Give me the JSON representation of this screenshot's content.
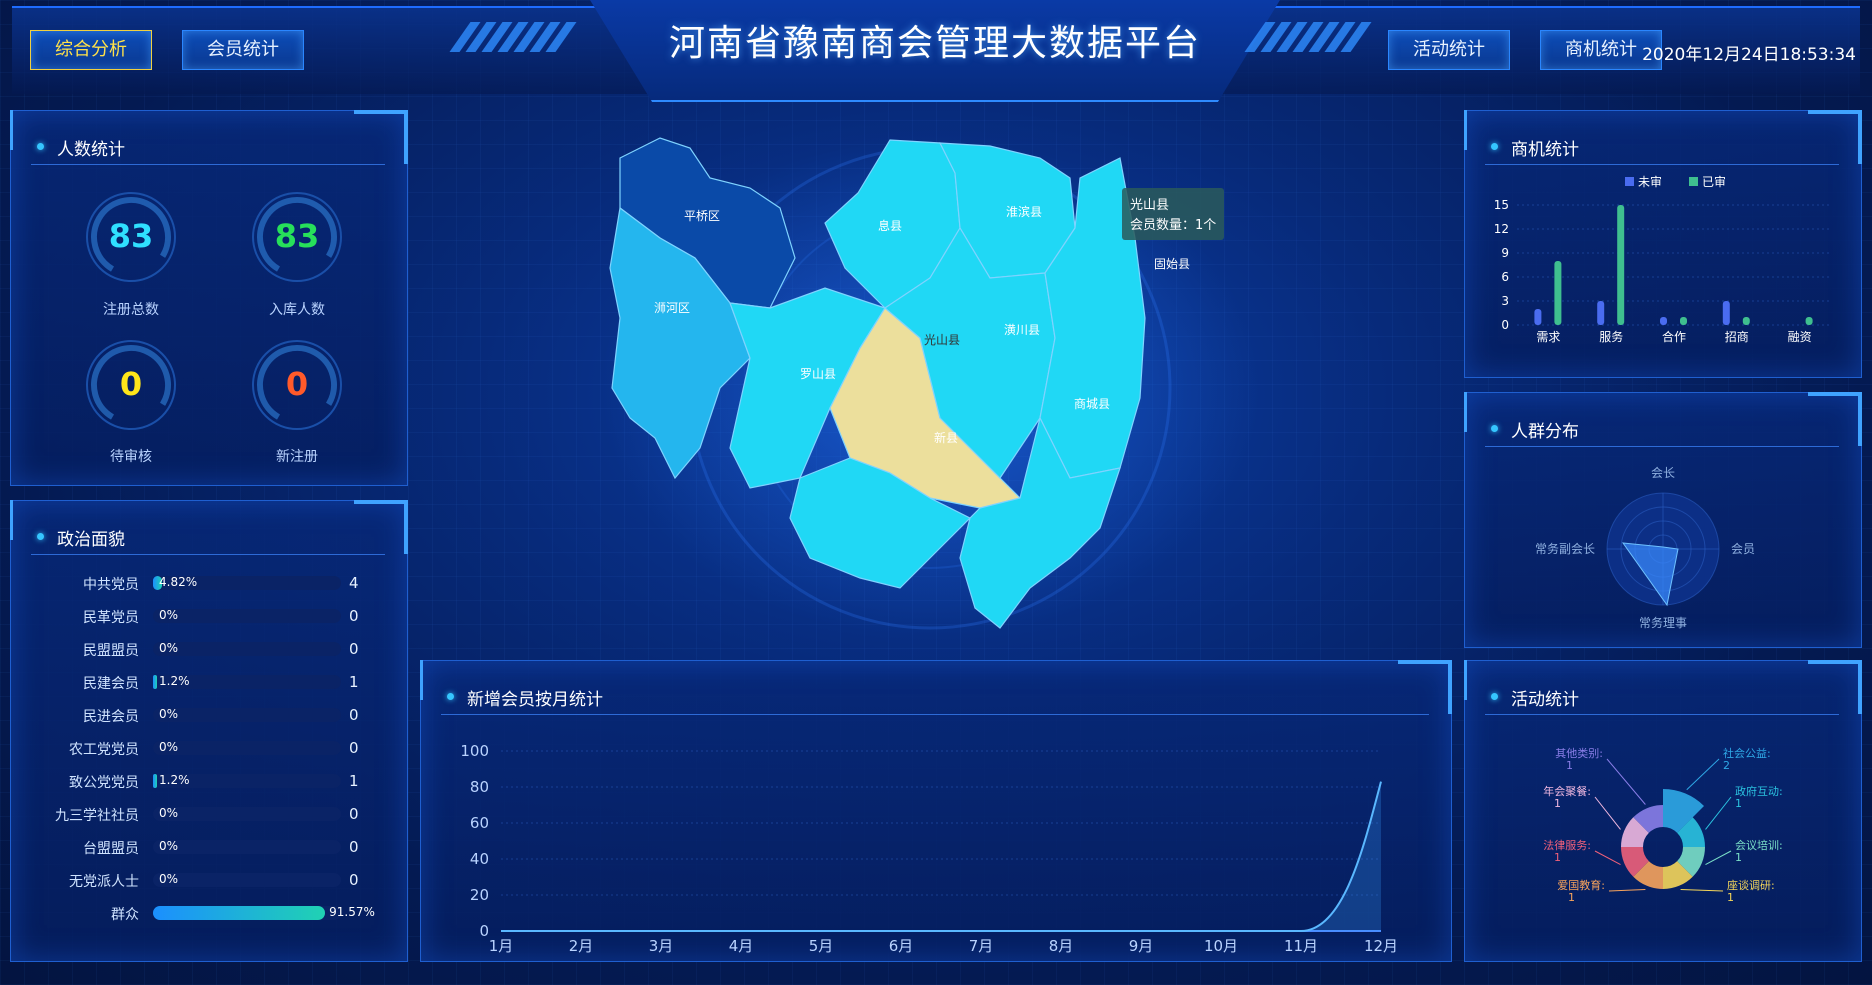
{
  "header": {
    "title": "河南省豫南商会管理大数据平台",
    "datetime": "2020年12月24日18:53:34",
    "nav_left": [
      "综合分析",
      "会员统计"
    ],
    "nav_right": [
      "活动统计",
      "商机统计"
    ],
    "active_tab": "综合分析"
  },
  "people_stats": {
    "title": "人数统计",
    "gauges": [
      {
        "value": "83",
        "label": "注册总数",
        "color": "#2fe0ff"
      },
      {
        "value": "83",
        "label": "入库人数",
        "color": "#27e05a"
      },
      {
        "value": "0",
        "label": "待审核",
        "color": "#ffe61a"
      },
      {
        "value": "0",
        "label": "新注册",
        "color": "#ff5a2a"
      }
    ]
  },
  "political": {
    "title": "政治面貌",
    "rows": [
      {
        "name": "中共党员",
        "pct": "4.82%",
        "fraction": 0.0482,
        "count": "4"
      },
      {
        "name": "民革党员",
        "pct": "0%",
        "fraction": 0,
        "count": "0"
      },
      {
        "name": "民盟盟员",
        "pct": "0%",
        "fraction": 0,
        "count": "0"
      },
      {
        "name": "民建会员",
        "pct": "1.2%",
        "fraction": 0.012,
        "count": "1"
      },
      {
        "name": "民进会员",
        "pct": "0%",
        "fraction": 0,
        "count": "0"
      },
      {
        "name": "农工党党员",
        "pct": "0%",
        "fraction": 0,
        "count": "0"
      },
      {
        "name": "致公党党员",
        "pct": "1.2%",
        "fraction": 0.012,
        "count": "1"
      },
      {
        "name": "九三学社社员",
        "pct": "0%",
        "fraction": 0,
        "count": "0"
      },
      {
        "name": "台盟盟员",
        "pct": "0%",
        "fraction": 0,
        "count": "0"
      },
      {
        "name": "无党派人士",
        "pct": "0%",
        "fraction": 0,
        "count": "0"
      },
      {
        "name": "群众",
        "pct": "91.57%",
        "fraction": 0.9157,
        "count": ""
      }
    ]
  },
  "map": {
    "regions": [
      "平桥区",
      "浉河区",
      "息县",
      "淮滨县",
      "罗山县",
      "光山县",
      "潢川县",
      "固始县",
      "新县",
      "商城县"
    ],
    "tooltip": {
      "name": "光山县",
      "line": "会员数量：1个"
    }
  },
  "chart_data": [
    {
      "id": "monthly",
      "type": "area",
      "title": "新增会员按月统计",
      "categories": [
        "1月",
        "2月",
        "3月",
        "4月",
        "5月",
        "6月",
        "7月",
        "8月",
        "9月",
        "10月",
        "11月",
        "12月"
      ],
      "values": [
        0,
        0,
        0,
        0,
        0,
        0,
        0,
        0,
        0,
        0,
        0,
        83
      ],
      "ylim": [
        0,
        100
      ],
      "yticks": [
        "0",
        "20",
        "40",
        "60",
        "80",
        "100"
      ]
    },
    {
      "id": "opportunity",
      "type": "bar",
      "title": "商机统计",
      "categories": [
        "需求",
        "服务",
        "合作",
        "招商",
        "融资"
      ],
      "series": [
        {
          "name": "未审",
          "values": [
            2,
            3,
            1,
            3,
            0
          ],
          "color": "#4a6cf0"
        },
        {
          "name": "已审",
          "values": [
            8,
            15,
            1,
            1,
            1
          ],
          "color": "#3fbf8f"
        }
      ],
      "ylim": [
        0,
        15
      ],
      "yticks": [
        "0",
        "3",
        "6",
        "9",
        "12",
        "15"
      ]
    },
    {
      "id": "crowd",
      "type": "radar",
      "title": "人群分布",
      "indicators": [
        "会长",
        "会员",
        "常务理事",
        "常务副会长"
      ]
    },
    {
      "id": "activity",
      "type": "pie",
      "title": "活动统计",
      "slices": [
        {
          "label": "社会公益:",
          "value": "2",
          "color": "#2fa8e6"
        },
        {
          "label": "政府互动:",
          "value": "1",
          "color": "#2bc3e0"
        },
        {
          "label": "会议培训:",
          "value": "1",
          "color": "#7be0c8"
        },
        {
          "label": "座谈调研:",
          "value": "1",
          "color": "#f5d65a"
        },
        {
          "label": "爱国教育:",
          "value": "1",
          "color": "#f7a35c"
        },
        {
          "label": "法律服务:",
          "value": "1",
          "color": "#f0607a"
        },
        {
          "label": "年会聚餐:",
          "value": "1",
          "color": "#f0b8e0"
        },
        {
          "label": "其他类别:",
          "value": "1",
          "color": "#8a7ee8"
        }
      ]
    }
  ]
}
